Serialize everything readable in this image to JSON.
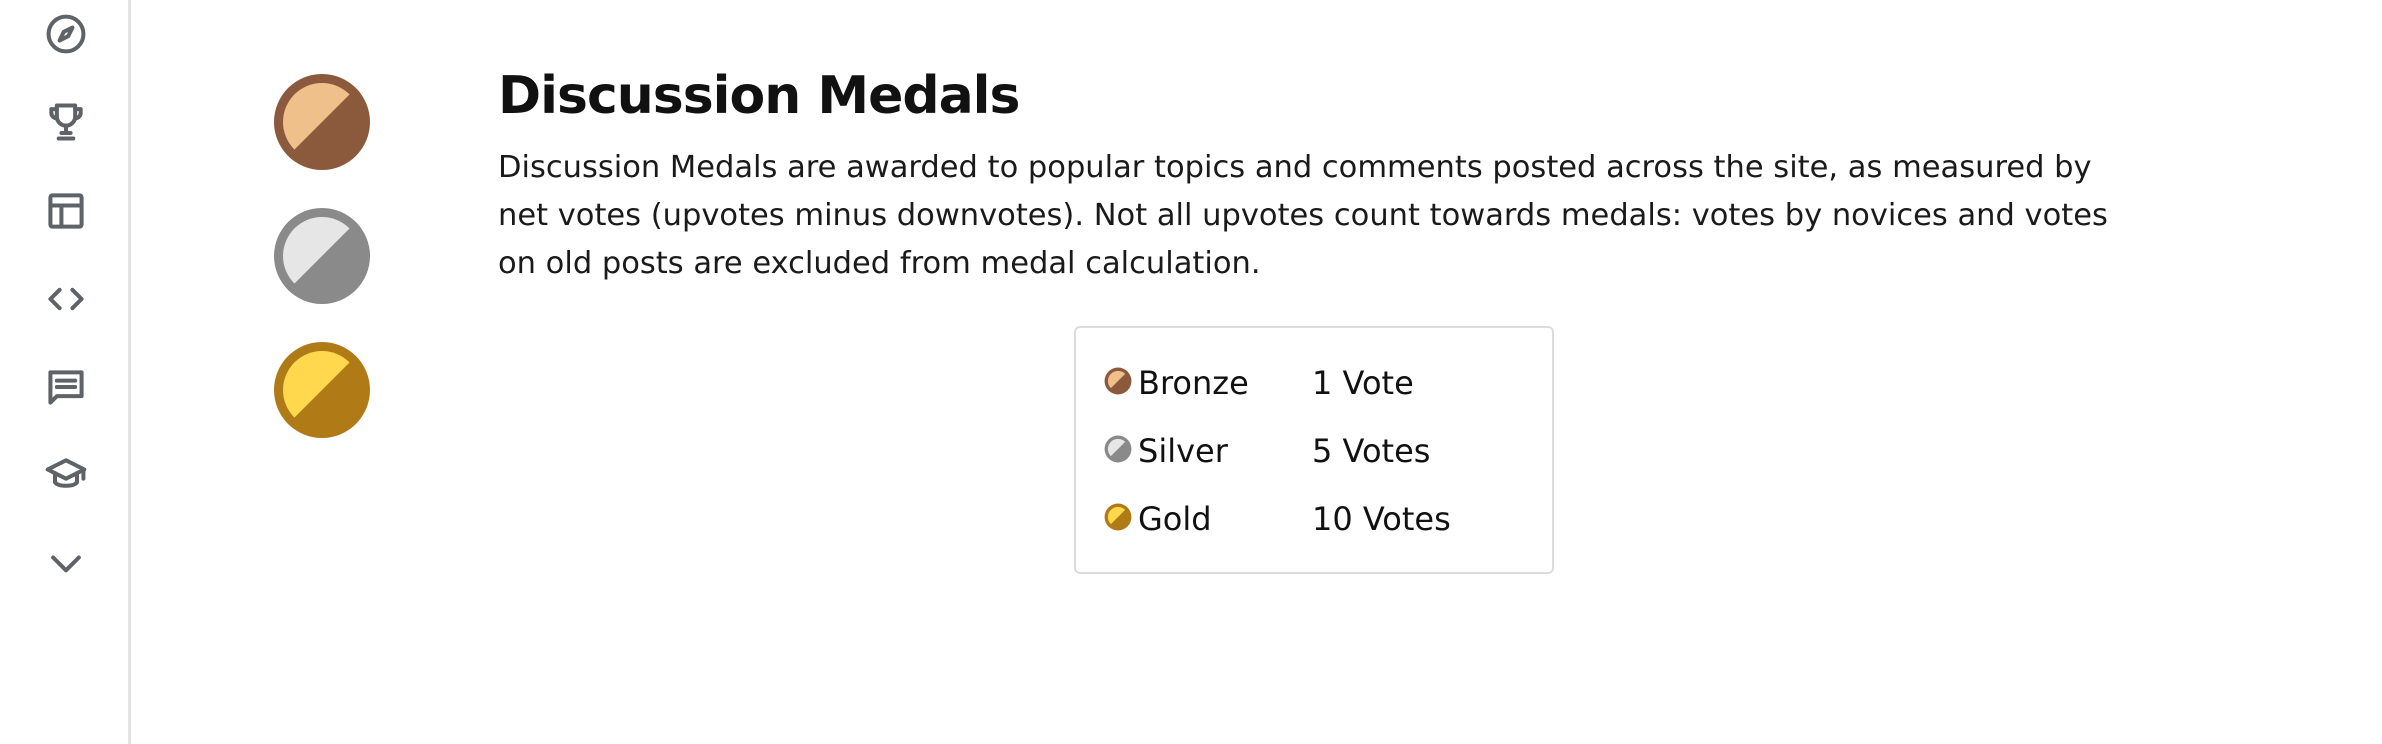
{
  "sidebar": {
    "items": [
      {
        "icon": "compass-icon",
        "name": "nav-explore"
      },
      {
        "icon": "trophy-icon",
        "name": "nav-leaderboards"
      },
      {
        "icon": "table-icon",
        "name": "nav-datasets"
      },
      {
        "icon": "code-icon",
        "name": "nav-code"
      },
      {
        "icon": "comments-icon",
        "name": "nav-discussions"
      },
      {
        "icon": "graduation-cap-icon",
        "name": "nav-learn"
      },
      {
        "icon": "chevron-down-icon",
        "name": "nav-more"
      }
    ]
  },
  "section": {
    "title": "Discussion Medals",
    "description": "Discussion Medals are awarded to popular topics and comments posted across the site, as measured by net votes (upvotes minus downvotes). Not all upvotes count towards medals: votes by novices and votes on old posts are excluded from medal calculation."
  },
  "medals": [
    {
      "name": "Bronze",
      "votes": "1 Vote",
      "light": "#f0c08a",
      "dark": "#8b5a3c",
      "icon": "bronze-medal-icon"
    },
    {
      "name": "Silver",
      "votes": "5 Votes",
      "light": "#e6e6e6",
      "dark": "#8a8a8a",
      "icon": "silver-medal-icon"
    },
    {
      "name": "Gold",
      "votes": "10 Votes",
      "light": "#ffd84d",
      "dark": "#b07a16",
      "icon": "gold-medal-icon"
    }
  ]
}
